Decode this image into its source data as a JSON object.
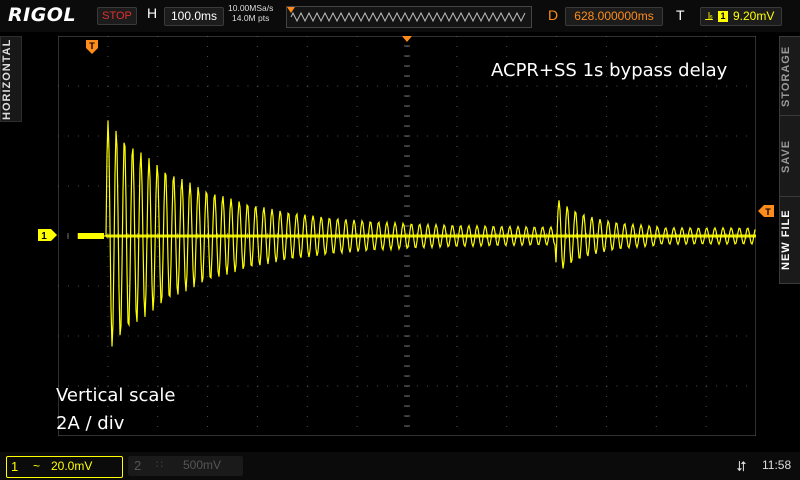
{
  "header": {
    "brand": "RIGOL",
    "run_state": "STOP",
    "h_label": "H",
    "timebase": "100.0ms",
    "sample_rate": "10.00MSa/s",
    "memory_depth": "14.0M pts",
    "d_label": "D",
    "delay": "628.000000ms",
    "t_label": "T",
    "trigger_channel": "1",
    "trigger_level": "9.20mV"
  },
  "side_left": {
    "label": "HORIZONTAL"
  },
  "side_right": {
    "storage": "STORAGE",
    "save": "SAVE",
    "new_file": "NEW FILE"
  },
  "annotations": {
    "title": "ACPR+SS  1s bypass delay",
    "vscale_line1": "Vertical scale",
    "vscale_line2": "2A / div"
  },
  "markers": {
    "trigger_time": "T",
    "ch1": "1"
  },
  "footer": {
    "ch1": {
      "num": "1",
      "coupling": "~",
      "scale": "20.0mV"
    },
    "ch2": {
      "num": "2",
      "coupling": "∷",
      "scale": "500mV"
    },
    "time": "11:58"
  },
  "colors": {
    "ch1": "#ffff00",
    "stop": "#e03030",
    "delay": "#ff8c1a",
    "trigger_marker": "#ff8c1a",
    "grid": "#505050"
  },
  "icons": [
    "usb-icon",
    "trigger-edge-icon",
    "memory-bar-icon"
  ]
}
